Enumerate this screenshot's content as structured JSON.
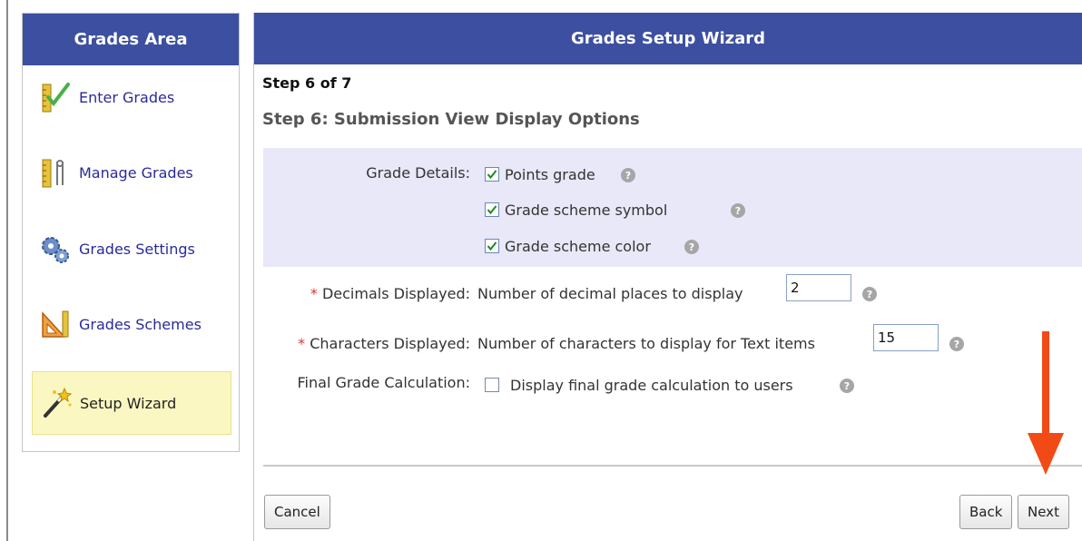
{
  "sidebar": {
    "title": "Grades Area",
    "items": [
      {
        "label": "Enter Grades",
        "icon": "ruler-check-icon",
        "active": false
      },
      {
        "label": "Manage Grades",
        "icon": "ruler-tools-icon",
        "active": false
      },
      {
        "label": "Grades Settings",
        "icon": "gears-icon",
        "active": false
      },
      {
        "label": "Grades Schemes",
        "icon": "set-square-icon",
        "active": false
      },
      {
        "label": "Setup Wizard",
        "icon": "magic-wand-icon",
        "active": true
      }
    ]
  },
  "wizard": {
    "title": "Grades Setup Wizard",
    "step_count": "Step 6 of 7",
    "step_title": "Step 6: Submission View Display Options",
    "grade_details": {
      "label": "Grade Details:",
      "options": [
        {
          "label": "Points grade",
          "checked": true
        },
        {
          "label": "Grade scheme symbol",
          "checked": true
        },
        {
          "label": "Grade scheme color",
          "checked": true
        }
      ]
    },
    "decimals": {
      "required_mark": "*",
      "label": "Decimals Displayed:",
      "description": "Number of decimal places to display",
      "value": "2"
    },
    "characters": {
      "required_mark": "*",
      "label": "Characters Displayed:",
      "description": "Number of characters to display for Text items",
      "value": "15"
    },
    "final_grade": {
      "label": "Final Grade Calculation:",
      "option_label": "Display final grade calculation to users",
      "checked": false
    },
    "help_glyph": "?"
  },
  "buttons": {
    "cancel": "Cancel",
    "back": "Back",
    "next": "Next"
  },
  "colors": {
    "header_bg": "#3c4fa0",
    "details_bg": "#e8e8f8",
    "active_item_bg": "#fbf7c2",
    "arrow": "#f24a16"
  }
}
